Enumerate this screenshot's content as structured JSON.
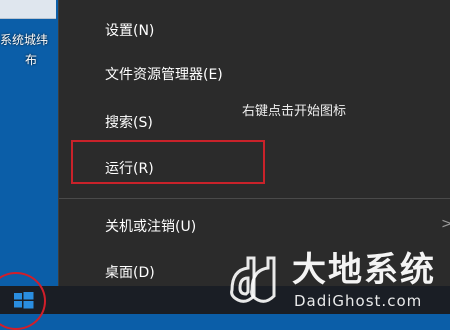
{
  "desktop": {
    "icon_label_line1": "系统城纬",
    "icon_label_line2": "布"
  },
  "context_menu": {
    "items": [
      {
        "label": "设置(N)"
      },
      {
        "label": "文件资源管理器(E)"
      },
      {
        "label": "搜索(S)"
      },
      {
        "label": "运行(R)"
      },
      {
        "label": "关机或注销(U)"
      },
      {
        "label": "桌面(D)"
      }
    ],
    "submenu_arrow": ">",
    "highlighted_item": "运行(R)"
  },
  "hint_text": "右键点击开始图标",
  "taskbar": {
    "start_icon": "windows-logo-icon"
  },
  "watermark": {
    "cn": "大地系统",
    "en": "DadiGhost.com"
  },
  "colors": {
    "desktop": "#0b5ea8",
    "menu_bg": "#2b2b2b",
    "highlight": "#c9222a",
    "taskbar": "#1a1e25",
    "windows_blue": "#2a8ee0"
  }
}
